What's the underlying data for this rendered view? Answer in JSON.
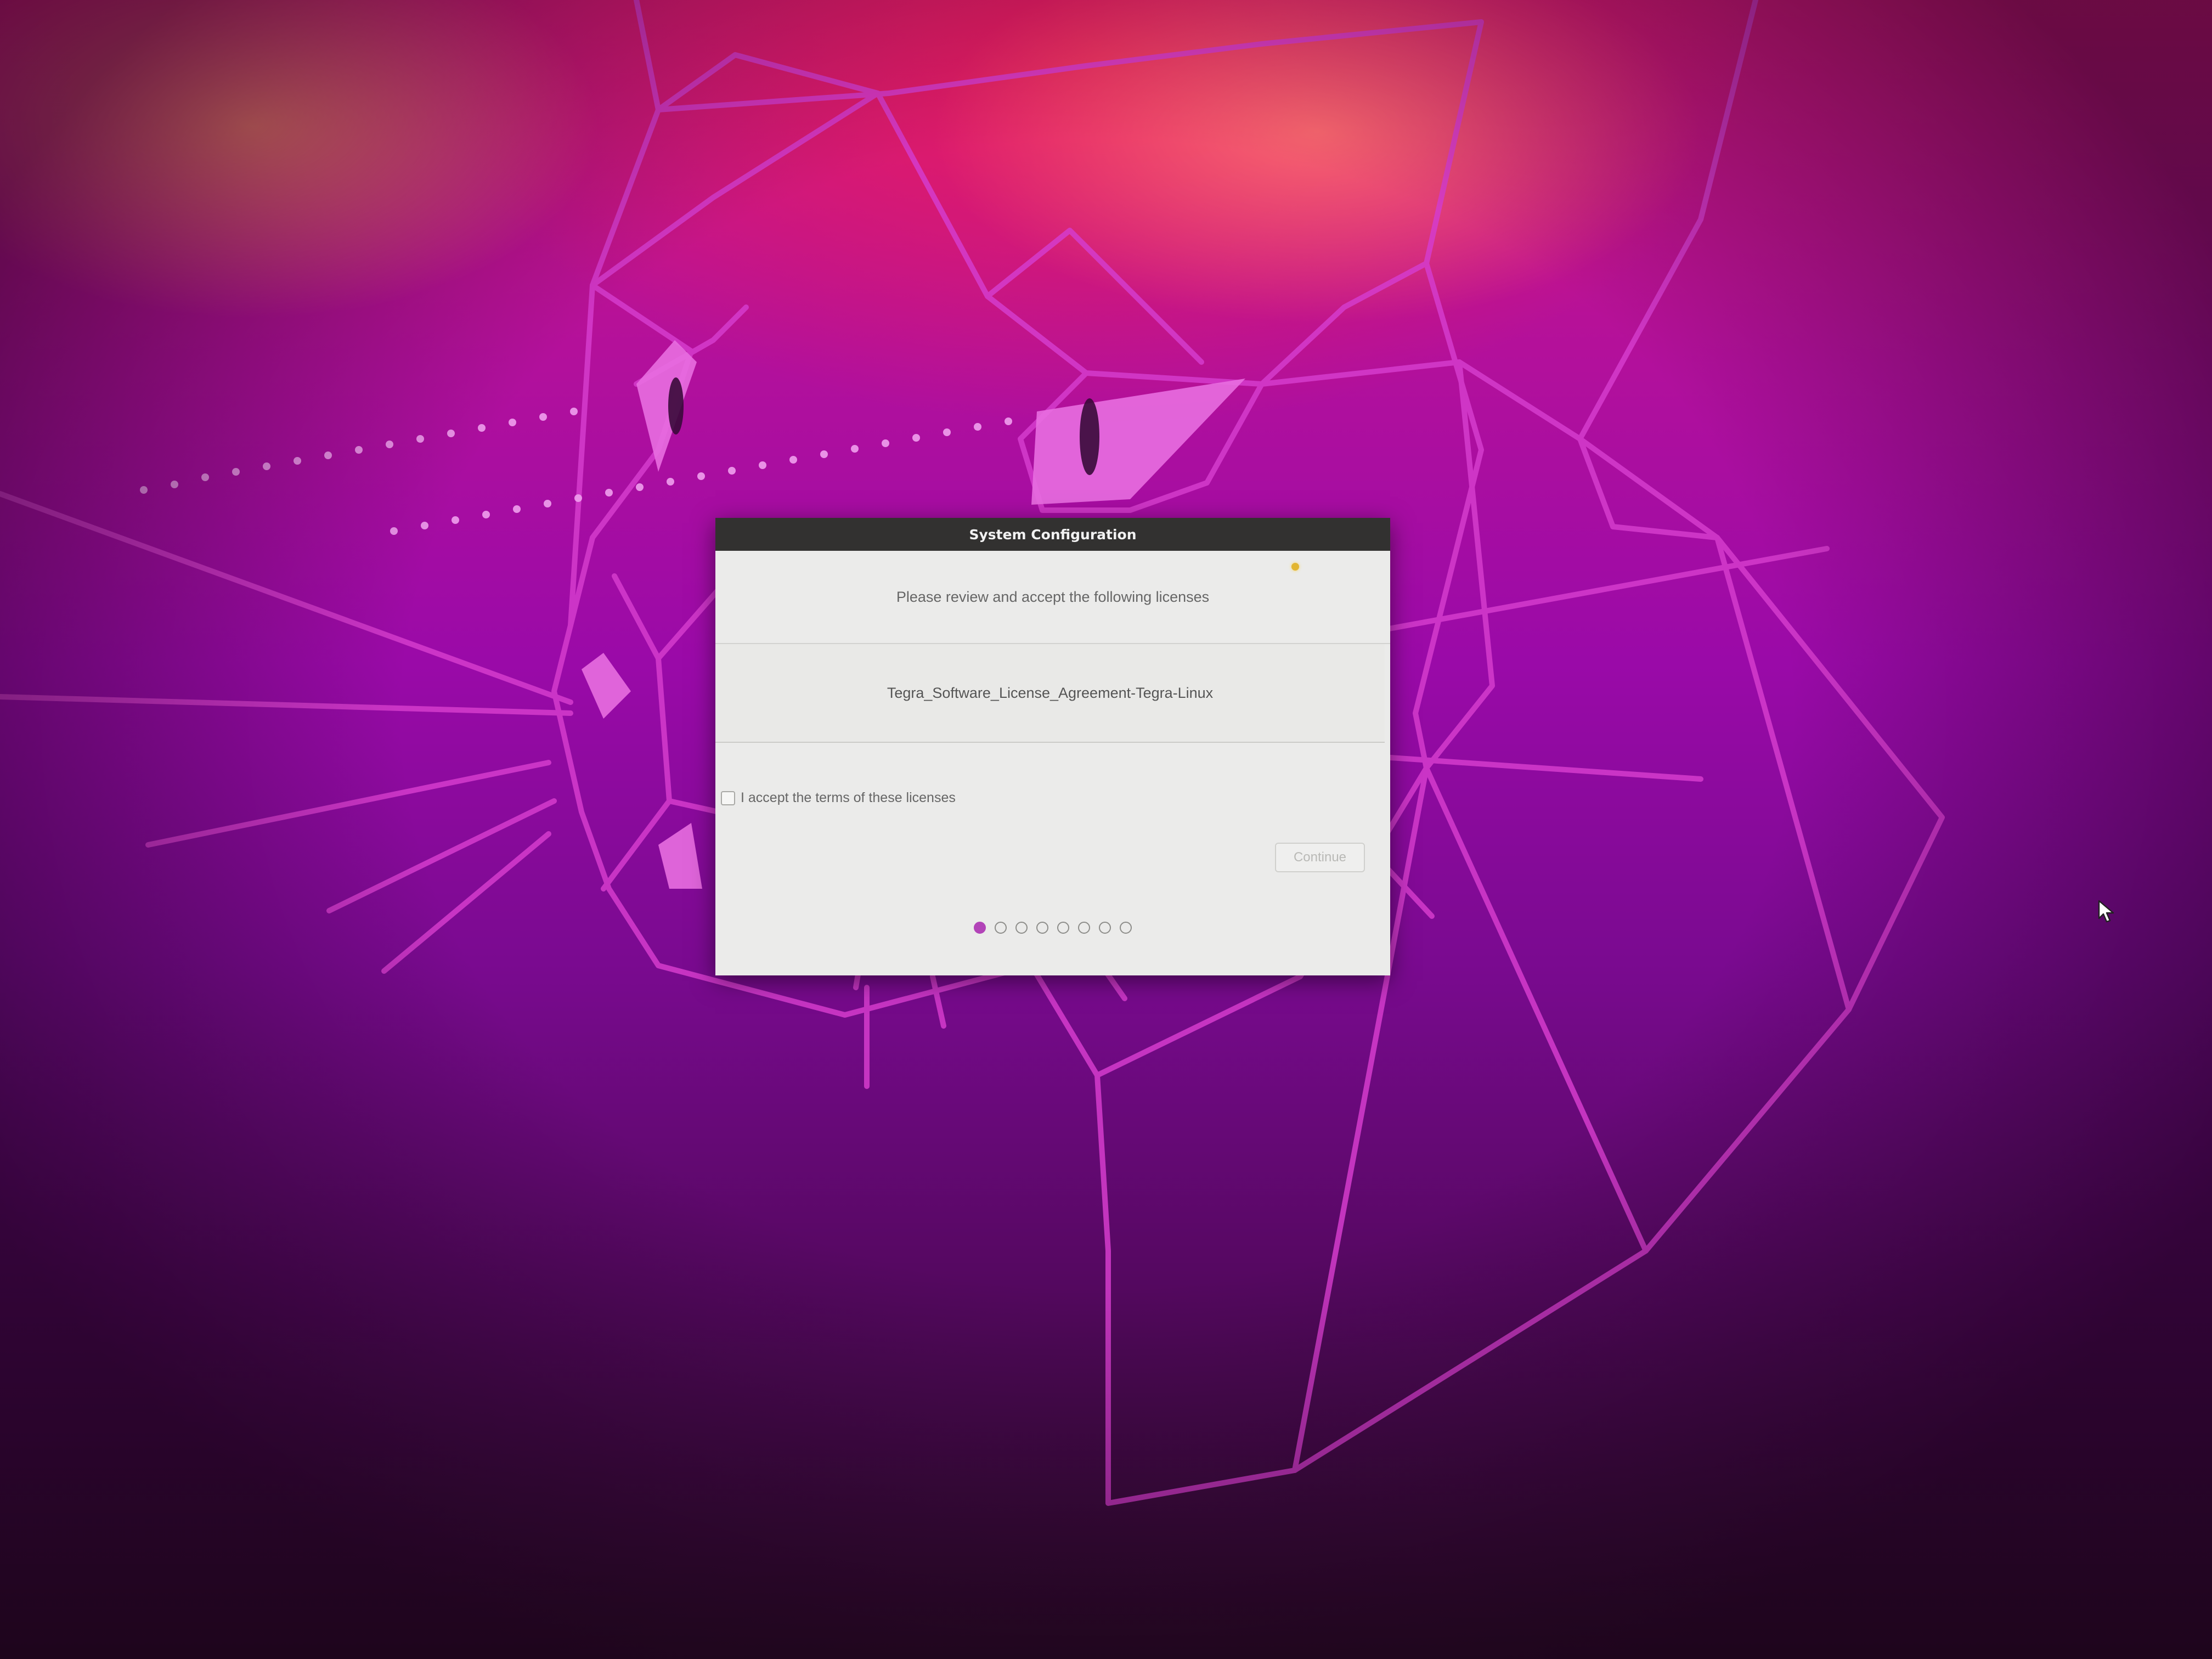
{
  "window": {
    "title": "System Configuration"
  },
  "header": {
    "message": "Please review and accept the following licenses"
  },
  "licenses": [
    "Tegra_Software_License_Agreement-Tegra-Linux"
  ],
  "accept": {
    "label": "I accept the terms of these licenses",
    "checked": false
  },
  "buttons": {
    "continue_label": "Continue",
    "continue_enabled": false
  },
  "pager": {
    "total_steps": 8,
    "current_step": 1
  },
  "colors": {
    "accent": "#b244b8",
    "titlebar": "#323130",
    "dialog_bg": "#ebebea",
    "wallpaper_lines": "#d93cc4"
  }
}
